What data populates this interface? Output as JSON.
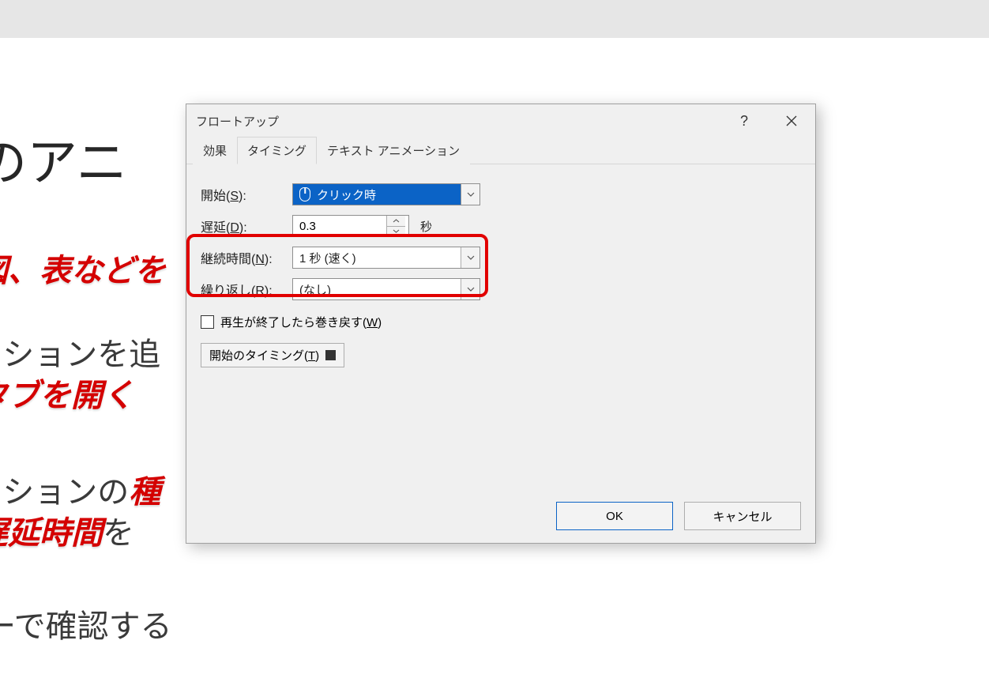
{
  "background": {
    "line1": "のアニ",
    "line2_red": "図、表などを",
    "line3a": "ーションを追",
    "line3b_red": "タブを開く",
    "line4a": "ーションの",
    "line4a_red": "種",
    "line4b_red": "遅延時間",
    "line4b_tail": "を",
    "line5": "ューで確認する"
  },
  "dialog": {
    "title": "フロートアップ",
    "help_label": "?",
    "tabs": {
      "effect": "効果",
      "timing": "タイミング",
      "text_anim": "テキスト アニメーション"
    },
    "fields": {
      "start_label_pre": "開始(",
      "start_label_key": "S",
      "start_label_post": "):",
      "start_value": "クリック時",
      "delay_label_pre": "遅延(",
      "delay_label_key": "D",
      "delay_label_post": "):",
      "delay_value": "0.3",
      "delay_unit": "秒",
      "duration_label_pre": "継続時間(",
      "duration_label_key": "N",
      "duration_label_post": "):",
      "duration_value": "1 秒 (速く)",
      "repeat_label_pre": "繰り返し(",
      "repeat_label_key": "R",
      "repeat_label_post": "):",
      "repeat_value": "(なし)",
      "rewind_pre": "再生が終了したら巻き戻す(",
      "rewind_key": "W",
      "rewind_post": ")",
      "trigger_pre": "開始のタイミング(",
      "trigger_key": "T",
      "trigger_post": ")"
    },
    "buttons": {
      "ok": "OK",
      "cancel": "キャンセル"
    }
  }
}
